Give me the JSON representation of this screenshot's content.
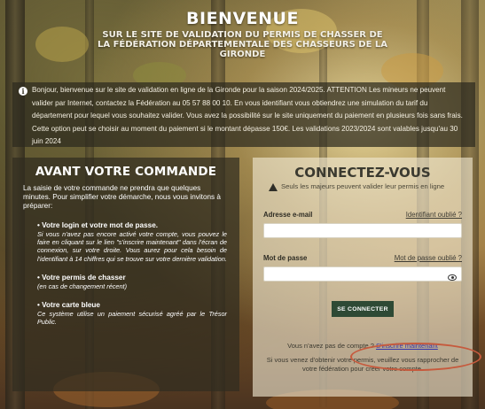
{
  "header": {
    "title": "BIENVENUE",
    "subtitle": "SUR LE SITE DE VALIDATION DU PERMIS DE CHASSER DE LA FÉDÉRATION DÉPARTEMENTALE DES CHASSEURS DE LA GIRONDE"
  },
  "notice": {
    "icon": "info-icon",
    "text": "Bonjour, bienvenue sur le site de validation en ligne de la Gironde pour la saison 2024/2025. ATTENTION Les mineurs ne peuvent valider par Internet, contactez la Fédération au 05 57 88 00 10. En vous identifiant vous obtiendrez une simulation du tarif du département pour lequel vous souhaitez valider. Vous avez la possibilité sur le site uniquement du paiement en plusieurs fois sans frais. Cette option peut se choisir au moment du paiement si le montant dépasse 150€. Les validations 2023/2024 sont valables jusqu'au 30 juin 2024"
  },
  "left": {
    "title": "AVANT VOTRE COMMANDE",
    "intro": "La saisie de votre commande ne prendra que quelques minutes. Pour simplifier votre démarche, nous vous invitons à préparer:",
    "steps": [
      {
        "title": "Votre login et votre mot de passe.",
        "desc": "Si vous n'avez pas encore activé votre compte, vous pouvez le faire en cliquant sur le lien \"s'inscrire maintenant\" dans l'écran de connexion, sur votre droite. Vous aurez pour cela besoin de l'identifiant à 14 chiffres qui se trouve sur votre dernière validation."
      },
      {
        "title": "Votre permis de chasser",
        "desc": "(en cas de changement récent)"
      },
      {
        "title": "Votre carte bleue",
        "desc": "Ce système utilise un paiement sécurisé agréé par le Trésor Public."
      }
    ]
  },
  "login": {
    "title": "CONNECTEZ-VOUS",
    "warning": "Seuls les majeurs peuvent valider leur permis en ligne",
    "email_label": "Adresse e-mail",
    "email_value": "",
    "forgot_id": "Identifiant oublié ?",
    "password_label": "Mot de passe",
    "password_value": "",
    "forgot_password": "Mot de passe oublié ?",
    "submit_label": "SE CONNECTER",
    "no_account": "Vous n'avez pas de compte ?",
    "register_link": "S'inscrire maintenant",
    "help": "Si vous venez d'obtenir votre permis, veuillez vous rapprocher de votre fédération pour créer votre compte."
  },
  "colors": {
    "button": "#2e4a35",
    "highlight": "#c65a3d",
    "link": "#3434a8"
  }
}
